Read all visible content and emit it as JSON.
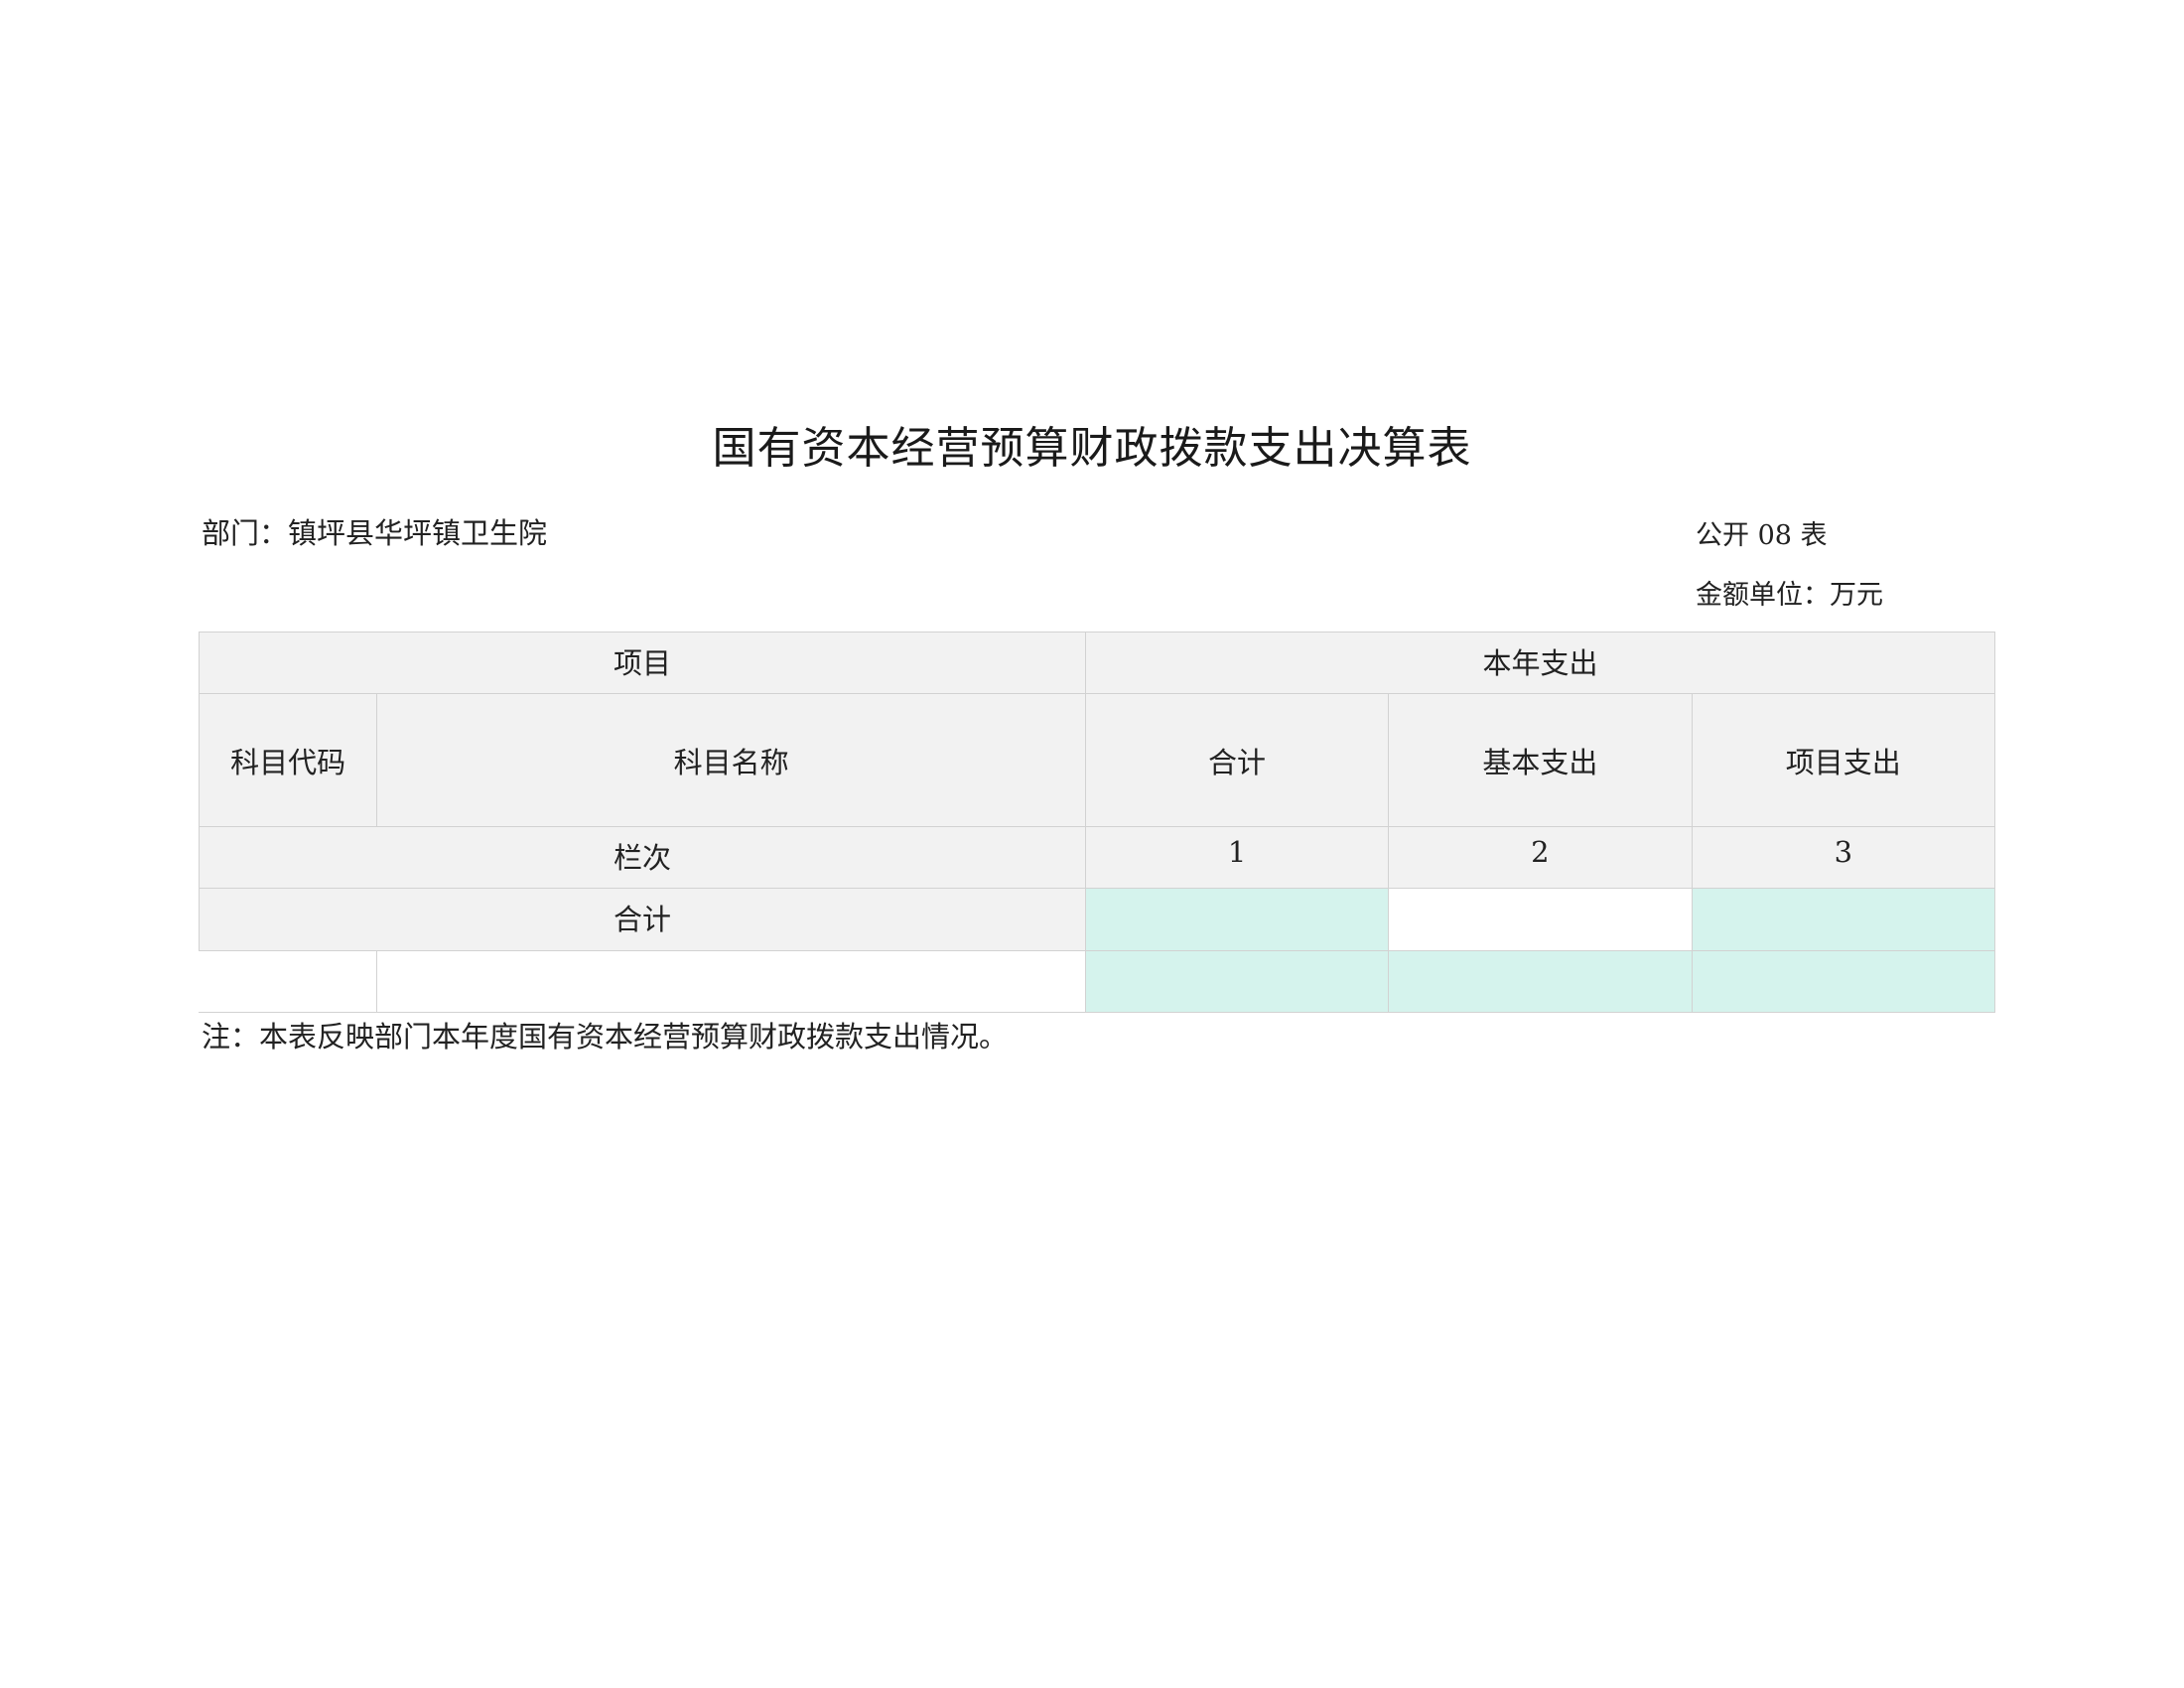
{
  "document": {
    "title": "国有资本经营预算财政拨款支出决算表",
    "department": "部门：镇坪县华坪镇卫生院",
    "form_number": "公开 08 表",
    "amount_unit": "金额单位：万元",
    "note": "注：本表反映部门本年度国有资本经营预算财政拨款支出情况。"
  },
  "table": {
    "header_project": "项目",
    "header_current_year": "本年支出",
    "col_code": "科目代码",
    "col_name": "科目名称",
    "col_total": "合计",
    "col_basic": "基本支出",
    "col_project": "项目支出",
    "row_column_order_label": "栏次",
    "column_numbers": [
      "1",
      "2",
      "3"
    ],
    "row_total_label": "合计",
    "row_total_values": [
      "",
      "",
      ""
    ],
    "data_rows": [
      {
        "code": "",
        "name": "",
        "total": "",
        "basic": "",
        "project": ""
      }
    ]
  },
  "colors": {
    "header_bg": "#f2f2f2",
    "value_cell_bg": "#d5f3ed",
    "border": "#d2d2d2"
  }
}
